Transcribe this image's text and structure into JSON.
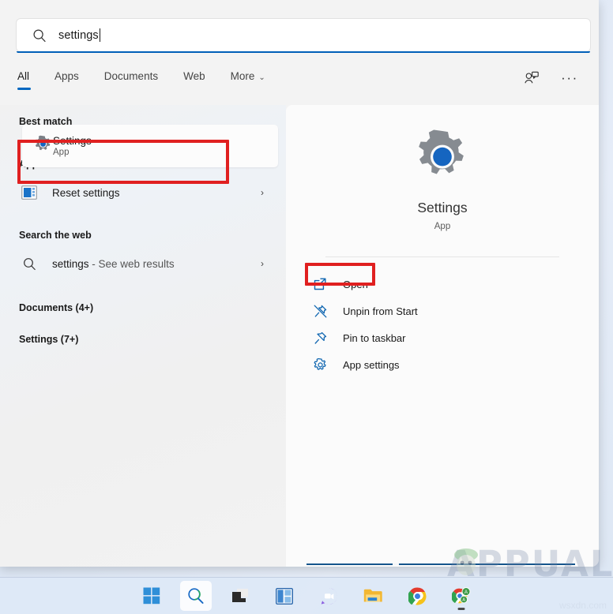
{
  "search": {
    "value": "settings",
    "icon": "search-icon"
  },
  "tabs": [
    {
      "label": "All",
      "active": true
    },
    {
      "label": "Apps",
      "active": false
    },
    {
      "label": "Documents",
      "active": false
    },
    {
      "label": "Web",
      "active": false
    },
    {
      "label": "More",
      "active": false,
      "chevron": "⌄"
    }
  ],
  "header_icons": [
    {
      "name": "feedback-icon",
      "label": "Feedback"
    },
    {
      "name": "more-options-icon",
      "label": "···"
    }
  ],
  "results": {
    "best_match": {
      "heading": "Best match",
      "title": "Settings",
      "subtitle": "App",
      "icon": "settings-gear-icon",
      "highlighted": true
    },
    "apps": {
      "heading": "Apps",
      "items": [
        {
          "title": "Reset settings",
          "icon": "control-panel-icon",
          "chevron": "›"
        }
      ]
    },
    "web": {
      "heading": "Search the web",
      "items": [
        {
          "title": "settings",
          "suffix": " - See web results",
          "icon": "search-icon",
          "chevron": "›"
        }
      ]
    },
    "more_sections": [
      {
        "heading": "Documents (4+)"
      },
      {
        "heading": "Settings (7+)"
      }
    ]
  },
  "preview": {
    "app_name": "Settings",
    "app_kind": "App",
    "icon": "settings-gear-icon",
    "actions": [
      {
        "label": "Open",
        "icon": "open-external-icon",
        "highlighted": true
      },
      {
        "label": "Unpin from Start",
        "icon": "unpin-icon",
        "highlighted": false
      },
      {
        "label": "Pin to taskbar",
        "icon": "pin-icon",
        "highlighted": false
      },
      {
        "label": "App settings",
        "icon": "gear-icon",
        "highlighted": false
      }
    ]
  },
  "taskbar": {
    "items": [
      {
        "name": "start-button",
        "label": "Start",
        "active": false
      },
      {
        "name": "search-button",
        "label": "Search",
        "active": true
      },
      {
        "name": "task-view-button",
        "label": "Task View",
        "active": false
      },
      {
        "name": "widgets-button",
        "label": "Widgets",
        "active": false
      },
      {
        "name": "chat-button",
        "label": "Chat",
        "active": false
      },
      {
        "name": "file-explorer-button",
        "label": "File Explorer",
        "active": false
      },
      {
        "name": "chrome-button",
        "label": "Google Chrome",
        "active": false
      },
      {
        "name": "chrome-secondary-button",
        "label": "Google Chrome",
        "active": false
      }
    ]
  },
  "watermarks": {
    "brand": "APPUALS",
    "site": "wsxdn.com"
  },
  "colors": {
    "accent": "#0067c0",
    "annotation": "#e02020",
    "panel_bg": "#fbfbfb",
    "list_bg": "#f1f1f1"
  }
}
